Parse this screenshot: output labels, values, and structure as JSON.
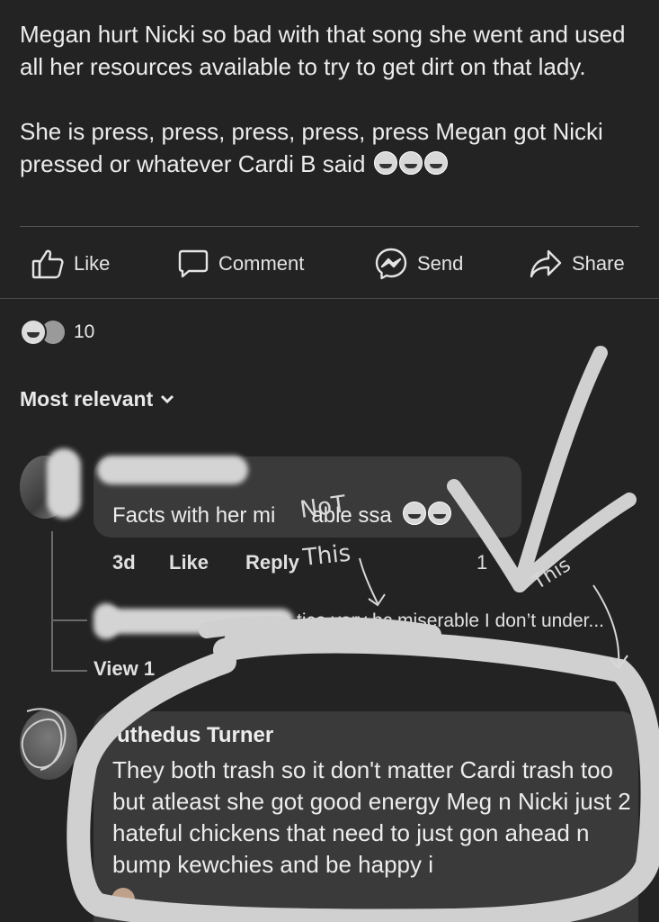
{
  "post": {
    "paragraph1": "Megan hurt Nicki so bad with that song she went and used all her resources available to try to get dirt on that lady.",
    "paragraph2": "She is press, press, press, press, press Megan got Nicki pressed or whatever Cardi B said"
  },
  "actions": {
    "like": "Like",
    "comment": "Comment",
    "send": "Send",
    "share": "Share"
  },
  "reactions": {
    "count": "10"
  },
  "sort": {
    "label": "Most relevant"
  },
  "comment1": {
    "text": "Facts with her mi",
    "text_tail": "able ssa",
    "time": "3d",
    "like": "Like",
    "reply": "Reply",
    "reaction_count": "1",
    "reply_preview": "tice very bc miserable I don’t under...",
    "view_more": "View 1"
  },
  "comment2": {
    "author": "uthedus Turner",
    "text": "They both trash so it don't matter Cardi trash too but atleast she got good energy Meg n Nicki just 2 hateful chickens that need to just gon ahead n bump kewchies and be happy i"
  },
  "annotations": {
    "not_this": "NoT This",
    "this": "This"
  },
  "colors": {
    "background": "#232323",
    "bubble": "#3a3a3a",
    "scribble": "#d0d0d0"
  }
}
